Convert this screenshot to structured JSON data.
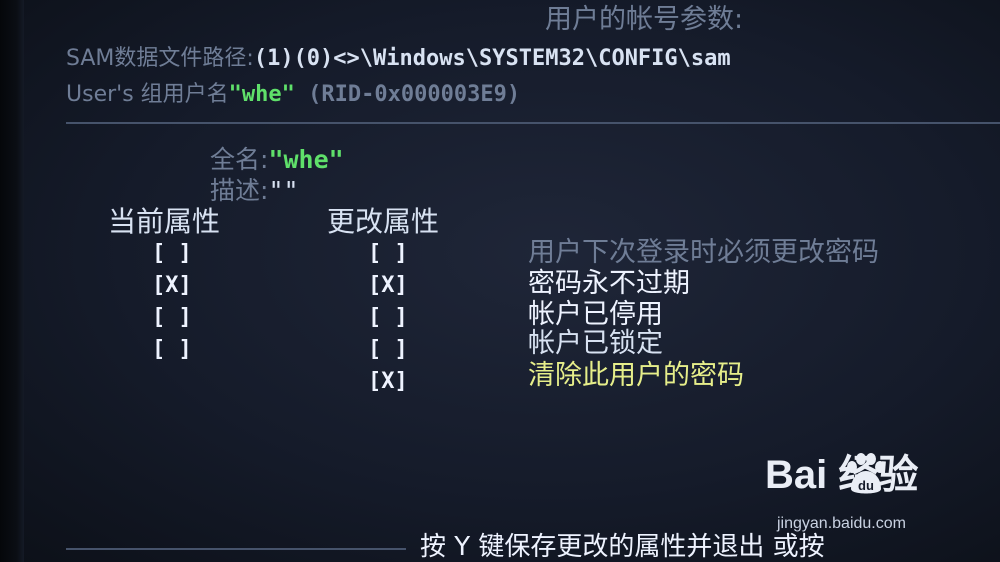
{
  "header": {
    "title": "用户的帐号参数:",
    "sam_label": "SAM数据文件路径:",
    "sam_path": "(1)(0)<>\\Windows\\SYSTEM32\\CONFIG\\sam",
    "user_prefix": "User's 组用户名",
    "user_name": "\"whe\"",
    "rid": "(RID-0x000003E9)"
  },
  "account": {
    "fullname_label": "全名:",
    "fullname_value": "\"whe\"",
    "desc_label": "描述:",
    "desc_value": "\"\""
  },
  "columns": {
    "current": "当前属性",
    "change": "更改属性"
  },
  "options": [
    {
      "current": "[ ]",
      "change": "[ ]",
      "label": "用户下次登录时必须更改密码"
    },
    {
      "current": "[X]",
      "change": "[X]",
      "label": "密码永不过期"
    },
    {
      "current": "[ ]",
      "change": "[ ]",
      "label": "帐户已停用"
    },
    {
      "current": "[ ]",
      "change": "[ ]",
      "label": "帐户已锁定"
    },
    {
      "current": "",
      "change": "[X]",
      "label": "清除此用户的密码"
    }
  ],
  "footer": {
    "text": "按 Y 键保存更改的属性并退出 或按"
  },
  "watermark": {
    "logo_text": "Bai  经验",
    "paw_text": "du",
    "url": "jingyan.baidu.com"
  },
  "colors": {
    "background": "#151b2a",
    "dim_text": "#6f7d96",
    "highlight_green": "#5fe06a",
    "highlight_yellow": "#e6ee8a"
  }
}
